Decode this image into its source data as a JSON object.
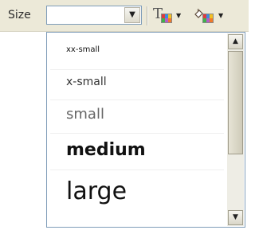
{
  "toolbar": {
    "size_label": "Size",
    "size_value": "",
    "dropdown_arrow_icon": "chevron-down-icon",
    "text_color_glyph": "T",
    "background_color_icon": "paint-bucket-icon"
  },
  "size_list": {
    "items": [
      "xx-small",
      "x-small",
      "small",
      "medium",
      "large"
    ]
  },
  "scrollbar": {
    "up_icon": "arrow-up-icon",
    "down_icon": "arrow-down-icon"
  },
  "colors": {
    "toolbar_bg": "#ece9d8",
    "border": "#7f9db9"
  }
}
